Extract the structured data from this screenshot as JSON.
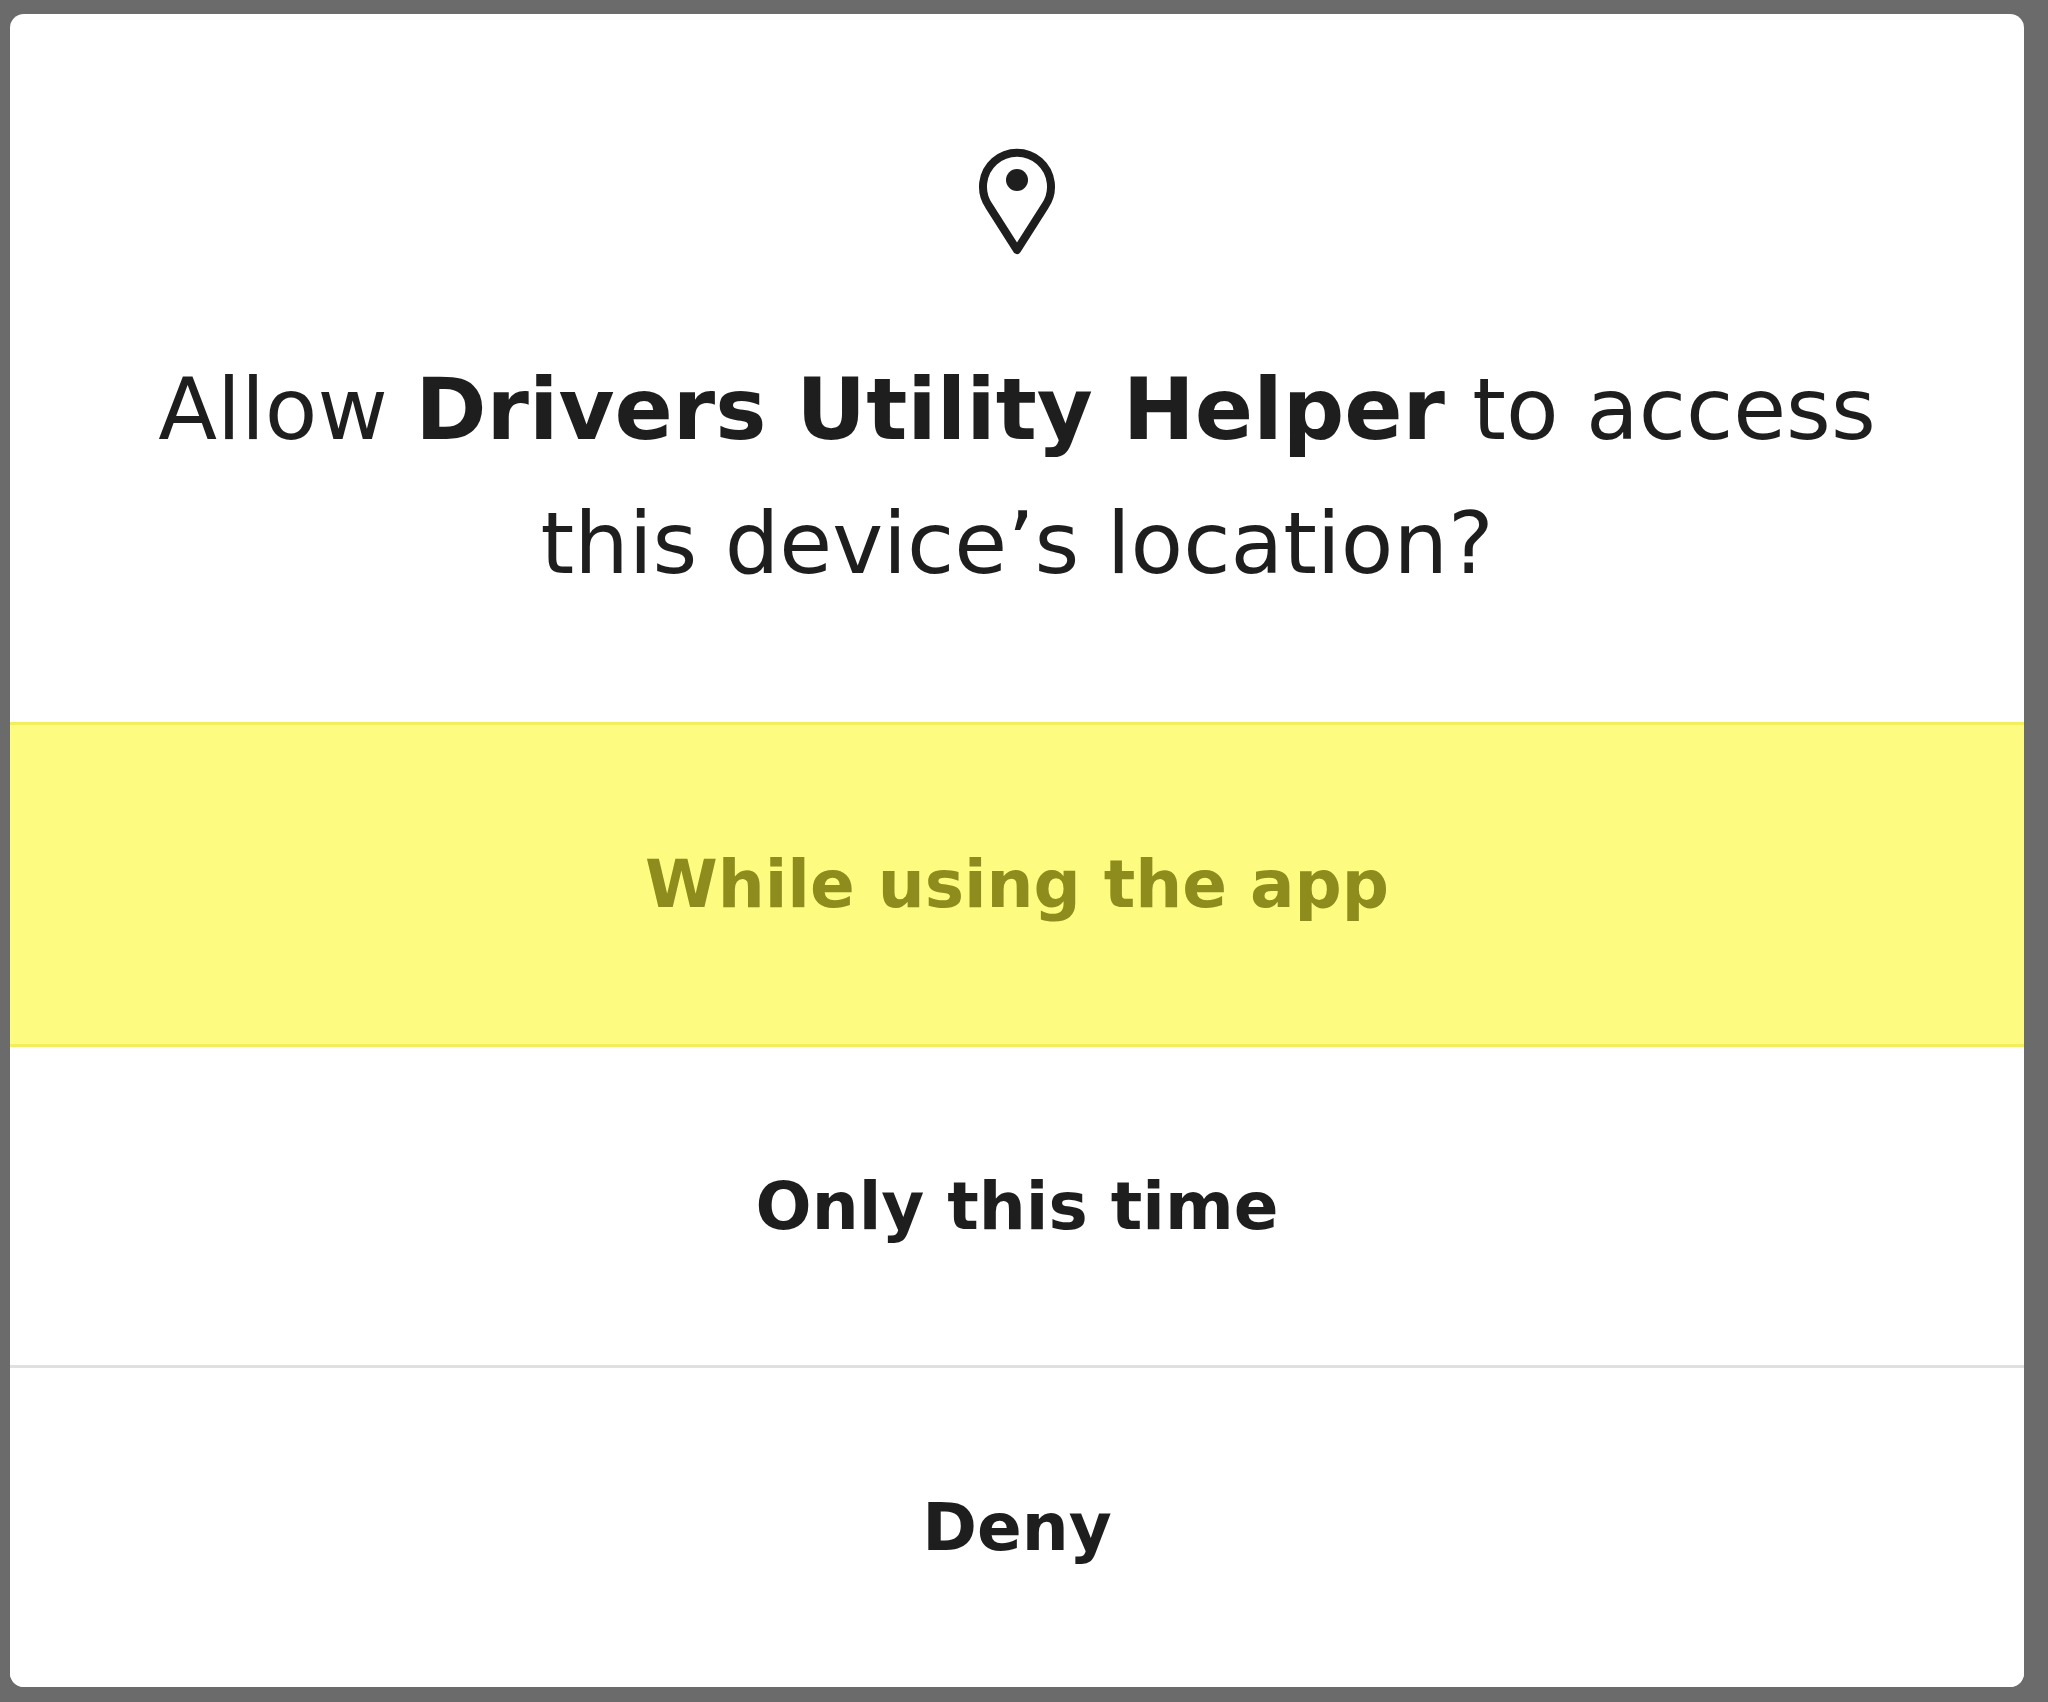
{
  "dialog": {
    "title": "Allow **Drivers Utility Helper** to access this device’s location?",
    "options": [
      {
        "label": "While using the app",
        "selected": true
      },
      {
        "label": "Only this time",
        "selected": false
      },
      {
        "label": "Deny",
        "selected": false
      }
    ]
  }
}
